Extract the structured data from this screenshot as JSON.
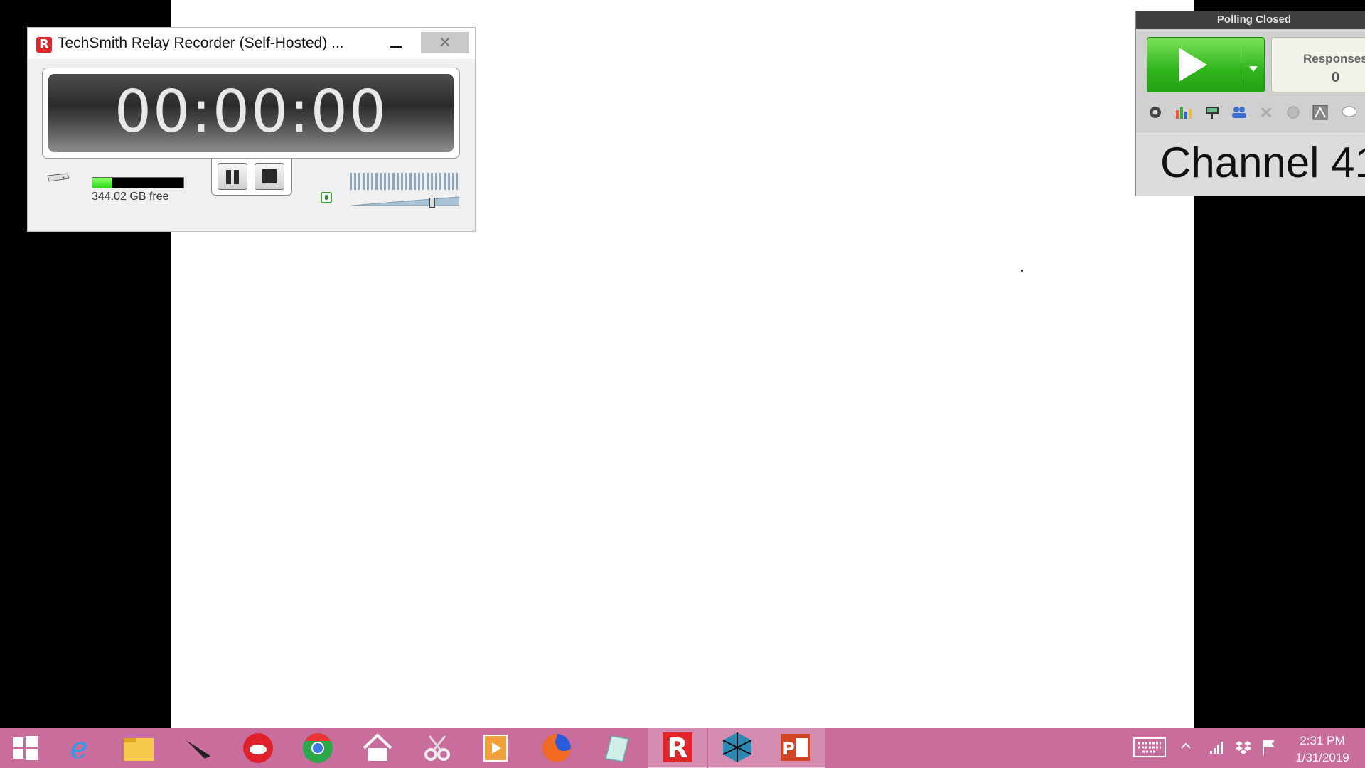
{
  "recorder": {
    "title": "TechSmith Relay Recorder (Self-Hosted) ...",
    "app_icon_letter": "R",
    "close_glyph": "✕",
    "timer": "00:00:00",
    "disk_free": "344.02 GB free",
    "disk_used_fraction": 0.22,
    "volume_level": 0.75
  },
  "polling": {
    "status": "Polling Closed",
    "responses_label": "Responses",
    "responses_count": "0",
    "channel": "Channel 41",
    "toolbar_icons": [
      "gear-icon",
      "bar-chart-icon",
      "projector-icon",
      "participants-icon",
      "close-x-icon",
      "globe-icon",
      "chart-window-icon",
      "speech-bubble-icon"
    ]
  },
  "taskbar": {
    "apps": [
      "start-icon",
      "internet-explorer-icon",
      "file-explorer-icon",
      "pen-app-icon",
      "cloud-app-icon",
      "chrome-icon",
      "home-icon",
      "snipping-tool-icon",
      "media-player-icon",
      "firefox-icon",
      "notepad-icon",
      "relay-recorder-icon",
      "three-d-app-icon",
      "powerpoint-icon"
    ],
    "time": "2:31 PM",
    "date": "1/31/2019"
  },
  "colors": {
    "taskbar": "#c86d9c",
    "play_green": "#2fb51c",
    "disk_fill": "#2ed81a"
  }
}
